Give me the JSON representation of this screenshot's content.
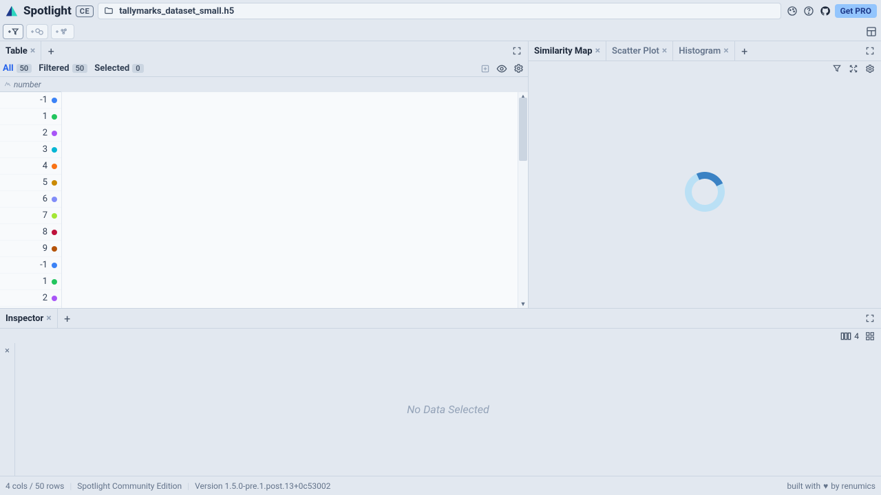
{
  "brand": {
    "name": "Spotlight",
    "edition_badge": "CE"
  },
  "file": {
    "name": "tallymarks_dataset_small.h5"
  },
  "header_buttons": {
    "get_pro": "Get PRO"
  },
  "left_panel": {
    "tabs": [
      {
        "label": "Table"
      }
    ],
    "counts": {
      "all_label": "All",
      "all_value": "50",
      "filtered_label": "Filtered",
      "filtered_value": "50",
      "selected_label": "Selected",
      "selected_value": "0"
    },
    "column_header": "number",
    "rows": [
      {
        "v": "-1",
        "c": "#3b82f6"
      },
      {
        "v": "1",
        "c": "#22c55e"
      },
      {
        "v": "2",
        "c": "#a855f7"
      },
      {
        "v": "3",
        "c": "#06b6d4"
      },
      {
        "v": "4",
        "c": "#f97316"
      },
      {
        "v": "5",
        "c": "#ca8a04"
      },
      {
        "v": "6",
        "c": "#818cf8"
      },
      {
        "v": "7",
        "c": "#a3e635"
      },
      {
        "v": "8",
        "c": "#be123c"
      },
      {
        "v": "9",
        "c": "#b45309"
      },
      {
        "v": "-1",
        "c": "#3b82f6"
      },
      {
        "v": "1",
        "c": "#22c55e"
      },
      {
        "v": "2",
        "c": "#a855f7"
      }
    ]
  },
  "right_panel": {
    "tabs": [
      {
        "label": "Similarity Map",
        "active": true
      },
      {
        "label": "Scatter Plot",
        "active": false
      },
      {
        "label": "Histogram",
        "active": false
      }
    ]
  },
  "inspector": {
    "tabs": [
      {
        "label": "Inspector"
      }
    ],
    "view_count": "4",
    "empty_message": "No Data Selected"
  },
  "status": {
    "shape": "4 cols / 50 rows",
    "edition": "Spotlight Community Edition",
    "version": "Version 1.5.0-pre.1.post.13+0c53002",
    "built_with": "built with",
    "by": "by renumics"
  }
}
